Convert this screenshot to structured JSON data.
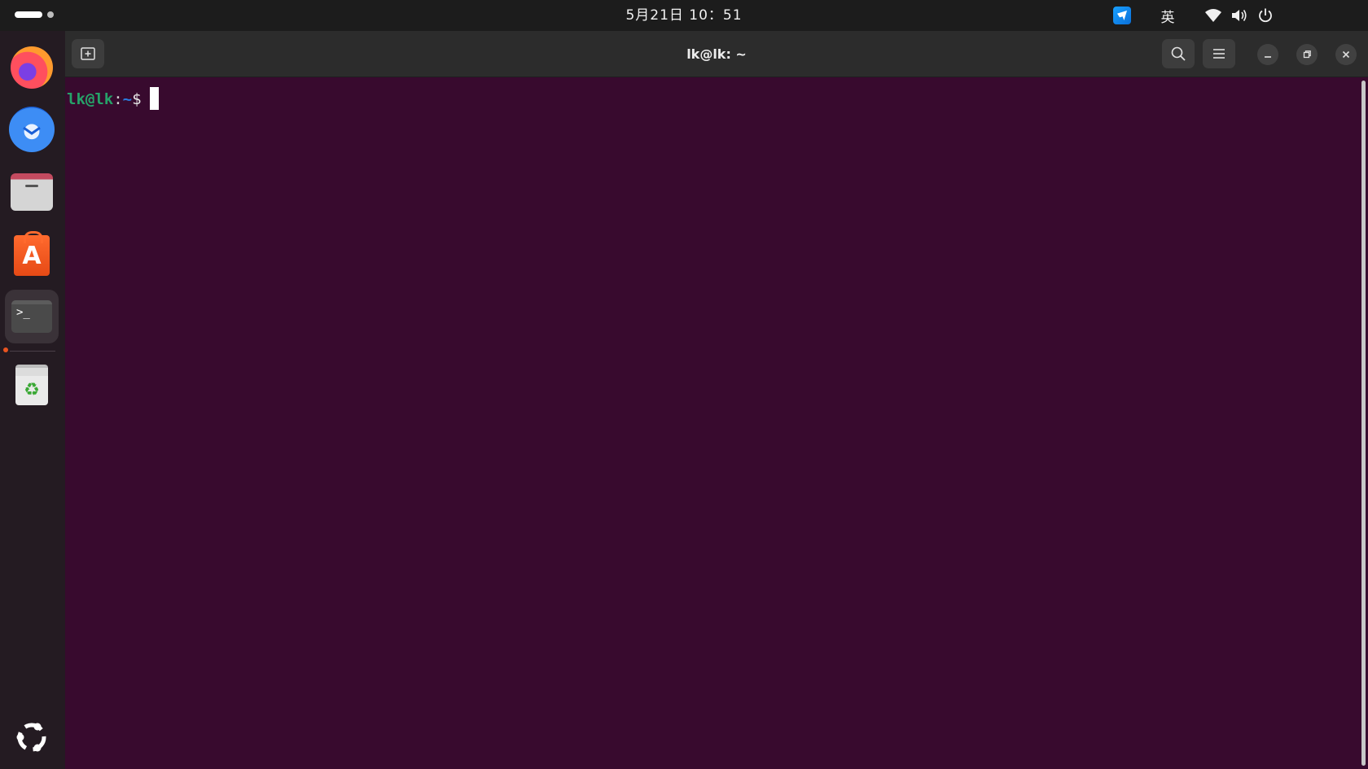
{
  "topbar": {
    "clock": "5月21日  10：51",
    "input_method": "英",
    "icons": [
      "activities-indicator",
      "app-tray-icon",
      "wifi-icon",
      "volume-icon",
      "power-icon"
    ]
  },
  "dock": {
    "items": [
      {
        "name": "firefox",
        "icon": "firefox-icon"
      },
      {
        "name": "thunderbird",
        "icon": "thunderbird-icon"
      },
      {
        "name": "files",
        "icon": "files-icon"
      },
      {
        "name": "app-center",
        "icon": "app-center-icon",
        "glyph": "A"
      },
      {
        "name": "terminal",
        "icon": "terminal-icon",
        "glyph": ">_",
        "active": true
      },
      {
        "name": "trash",
        "icon": "trash-icon",
        "glyph": "♻"
      },
      {
        "name": "show-apps",
        "icon": "ubuntu-apps-icon"
      }
    ]
  },
  "window": {
    "title": "lk@lk: ~",
    "buttons": [
      "new-tab-icon",
      "search-icon",
      "menu-icon",
      "minimize-icon",
      "maximize-icon",
      "close-icon"
    ]
  },
  "terminal": {
    "prompt_user": "lk@lk",
    "prompt_colon": ":",
    "prompt_path": "~",
    "prompt_symbol": "$"
  },
  "colors": {
    "terminal_bg": "#380a2e",
    "prompt_user": "#26a269",
    "prompt_path": "#2a7bde",
    "accent": "#e95420",
    "headerbar": "#2c2c2c",
    "dock_bg": "#241b22"
  }
}
